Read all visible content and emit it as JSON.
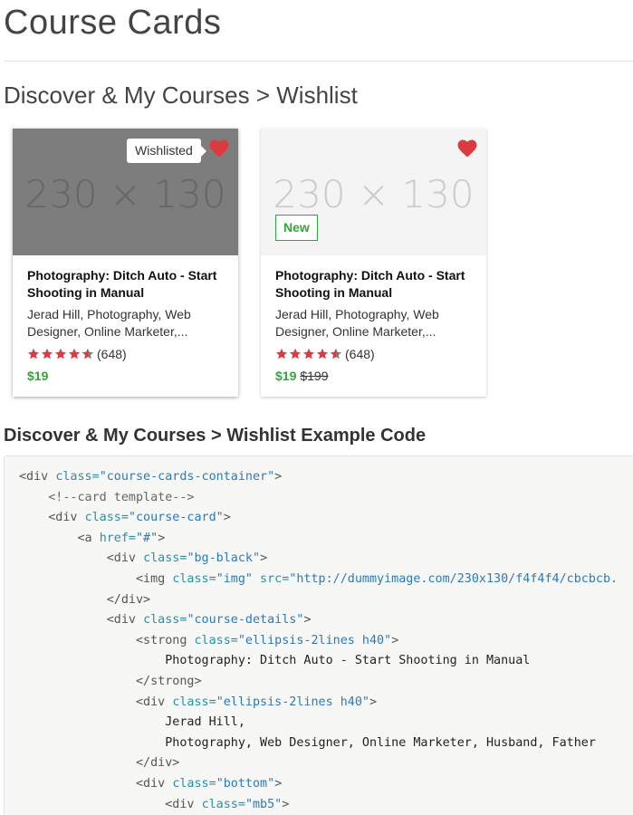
{
  "page": {
    "title": "Course Cards",
    "section_title": "Discover & My Courses > Wishlist",
    "code_title": "Discover & My Courses > Wishlist Example Code"
  },
  "colors": {
    "heart": "#dc3a41",
    "price": "#2ea836",
    "star": "#dc3a41"
  },
  "cards": [
    {
      "thumbnail_text": "230 × 130",
      "tooltip": "Wishlisted",
      "title": "Photography: Ditch Auto - Start Shooting in Manual",
      "instructors": "Jerad Hill, Photography, Web Designer, Online Marketer,...",
      "rating": 4.5,
      "review_count": "(648)",
      "price": "$19"
    },
    {
      "thumbnail_text": "230 × 130",
      "badge": "New",
      "title": "Photography: Ditch Auto - Start Shooting in Manual",
      "instructors": "Jerad Hill, Photography, Web Designer, Online Marketer,...",
      "rating": 4.5,
      "review_count": "(648)",
      "price": "$19",
      "old_price": "$199"
    }
  ],
  "code": {
    "l1_t1": "<div ",
    "l1_a1": "class=",
    "l1_v1": "\"course-cards-container\"",
    "l1_t2": ">",
    "l2_c": "<!--card template-->",
    "l3_t1": "<div ",
    "l3_a1": "class=",
    "l3_v1": "\"course-card\"",
    "l3_t2": ">",
    "l4_t1": "<a ",
    "l4_a1": "href=",
    "l4_v1": "\"#\"",
    "l4_t2": ">",
    "l5_t1": "<div ",
    "l5_a1": "class=",
    "l5_v1": "\"bg-black\"",
    "l5_t2": ">",
    "l6_t1": "<img ",
    "l6_a1": "class=",
    "l6_v1": "\"img\"",
    "l6_a2": " src=",
    "l6_v2": "\"http://dummyimage.com/230x130/f4f4f4/cbcbcb.",
    "l7_t1": "</div>",
    "l8_t1": "<div ",
    "l8_a1": "class=",
    "l8_v1": "\"course-details\"",
    "l8_t2": ">",
    "l9_t1": "<strong ",
    "l9_a1": "class=",
    "l9_v1": "\"ellipsis-2lines h40\"",
    "l9_t2": ">",
    "l10_x": "Photography: Ditch Auto - Start Shooting in Manual",
    "l11_t1": "</strong>",
    "l12_t1": "<div ",
    "l12_a1": "class=",
    "l12_v1": "\"ellipsis-2lines h40\"",
    "l12_t2": ">",
    "l13_x": "Jerad Hill,",
    "l14_x": "Photography, Web Designer, Online Marketer, Husband, Father",
    "l15_t1": "</div>",
    "l16_t1": "<div ",
    "l16_a1": "class=",
    "l16_v1": "\"bottom\"",
    "l16_t2": ">",
    "l17_t1": "<div ",
    "l17_a1": "class=",
    "l17_v1": "\"mb5\"",
    "l17_t2": ">"
  }
}
